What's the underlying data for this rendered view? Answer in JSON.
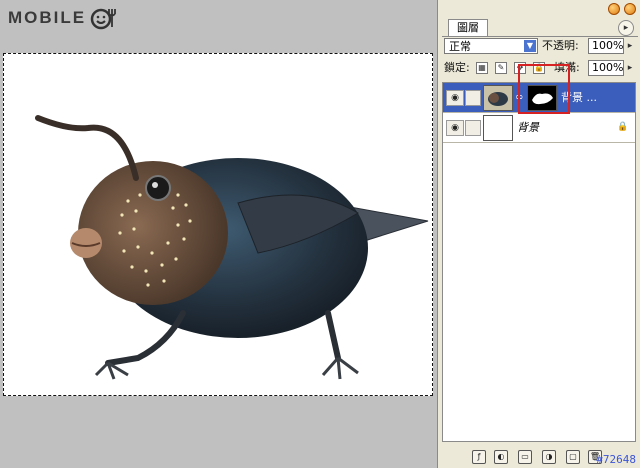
{
  "logo": {
    "text": "MOBILE"
  },
  "icons": {
    "logo": "smiley-fork-icon",
    "eye": "eye-icon",
    "link": "chain-link-icon",
    "lock": "lock-icon",
    "menu": "panel-menu-arrow-icon"
  },
  "panel": {
    "tab_label": "圖層",
    "blend_mode": "正常",
    "opacity_label": "不透明:",
    "opacity_value": "100%",
    "lock_label": "鎖定:",
    "fill_label": "填滿:",
    "fill_value": "100%"
  },
  "layers": [
    {
      "name": "背景 ...",
      "selected": true,
      "has_mask": true
    },
    {
      "name": "背景",
      "selected": false,
      "locked": true
    }
  ],
  "watermark": "#72648",
  "colors": {
    "selection_blue": "#3b5dbb",
    "highlight_red": "#d62222",
    "workspace_gray": "#c0c0c0",
    "panel_bg": "#ece9d8"
  }
}
